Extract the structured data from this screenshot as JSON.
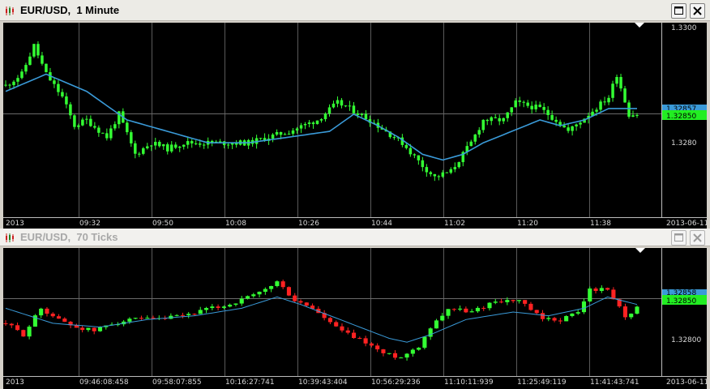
{
  "windows": [
    {
      "title": "EUR/USD,  1 Minute",
      "time_labels": [
        "2013",
        "09:32",
        "09:50",
        "10:08",
        "10:26",
        "10:44",
        "11:02",
        "11:20",
        "11:38",
        "2013-06-11"
      ],
      "price_labels": [
        "1.3300",
        "1.3280"
      ],
      "current_price": "1.32850",
      "ma_price": "1.32857",
      "chart_data": {
        "type": "candlestick",
        "instrument": "EUR/USD",
        "timeframe": "1 Minute",
        "x_labels": [
          "09:32",
          "09:50",
          "10:08",
          "10:26",
          "10:44",
          "11:02",
          "11:20",
          "11:38"
        ],
        "ylim": [
          1.3267,
          1.3301
        ],
        "bar_count": 157,
        "moving_average": true,
        "candle_colors": {
          "up": "#33ff33",
          "down": "#33ff33"
        },
        "ma_color": "#3a9ad8",
        "close_path": [
          [
            0,
            1.329
          ],
          [
            4,
            1.3292
          ],
          [
            7,
            1.3297
          ],
          [
            10,
            1.3292
          ],
          [
            14,
            1.3288
          ],
          [
            17,
            1.3283
          ],
          [
            20,
            1.3284
          ],
          [
            25,
            1.3281
          ],
          [
            28,
            1.3285
          ],
          [
            32,
            1.3278
          ],
          [
            36,
            1.328
          ],
          [
            40,
            1.3279
          ],
          [
            44,
            1.328
          ],
          [
            52,
            1.328
          ],
          [
            60,
            1.328
          ],
          [
            70,
            1.3282
          ],
          [
            77,
            1.3284
          ],
          [
            82,
            1.3287
          ],
          [
            85,
            1.3286
          ],
          [
            90,
            1.3284
          ],
          [
            94,
            1.3282
          ],
          [
            98,
            1.328
          ],
          [
            103,
            1.3276
          ],
          [
            106,
            1.3274
          ],
          [
            110,
            1.3275
          ],
          [
            115,
            1.328
          ],
          [
            118,
            1.3284
          ],
          [
            123,
            1.3284
          ],
          [
            126,
            1.3287
          ],
          [
            132,
            1.3286
          ],
          [
            136,
            1.3284
          ],
          [
            139,
            1.3282
          ],
          [
            144,
            1.3285
          ],
          [
            149,
            1.3288
          ],
          [
            151,
            1.3292
          ],
          [
            154,
            1.3285
          ],
          [
            156,
            1.3285
          ]
        ],
        "ma_path": [
          [
            0,
            1.3289
          ],
          [
            10,
            1.3292
          ],
          [
            20,
            1.3289
          ],
          [
            30,
            1.3284
          ],
          [
            40,
            1.3282
          ],
          [
            50,
            1.328
          ],
          [
            60,
            1.328
          ],
          [
            70,
            1.3281
          ],
          [
            80,
            1.3282
          ],
          [
            86,
            1.3285
          ],
          [
            92,
            1.3283
          ],
          [
            97,
            1.3281
          ],
          [
            103,
            1.3278
          ],
          [
            108,
            1.3277
          ],
          [
            113,
            1.3278
          ],
          [
            118,
            1.328
          ],
          [
            125,
            1.3282
          ],
          [
            132,
            1.3284
          ],
          [
            137,
            1.3283
          ],
          [
            143,
            1.3284
          ],
          [
            149,
            1.3286
          ],
          [
            152,
            1.3286
          ],
          [
            156,
            1.3286
          ]
        ],
        "seed": 11
      }
    },
    {
      "title": "EUR/USD,  70 Ticks",
      "time_labels": [
        "2013",
        "09:46:08:458",
        "09:58:07:855",
        "10:16:27:741",
        "10:39:43:404",
        "10:56:29:236",
        "11:10:11:939",
        "11:25:49:119",
        "11:41:43:741",
        "2013-06-11"
      ],
      "price_labels": [
        "1.32800"
      ],
      "current_price": "1.32850",
      "ma_price": "1.32858",
      "chart_data": {
        "type": "candlestick",
        "instrument": "EUR/USD",
        "timeframe": "70 Ticks",
        "x_labels": [
          "09:46:08:458",
          "09:58:07:855",
          "10:16:27:741",
          "10:39:43:404",
          "10:56:29:236",
          "11:10:11:939",
          "11:25:49:119",
          "11:41:43:741"
        ],
        "ylim": [
          1.3267,
          1.3301
        ],
        "bar_count": 108,
        "moving_average": true,
        "candle_colors": {
          "up": "#33ff33",
          "down": "#ff2222"
        },
        "ma_color": "#3a9ad8",
        "close_path": [
          [
            0,
            1.3281
          ],
          [
            3,
            1.3278
          ],
          [
            6,
            1.3285
          ],
          [
            9,
            1.3282
          ],
          [
            12,
            1.328
          ],
          [
            15,
            1.3279
          ],
          [
            18,
            1.3281
          ],
          [
            22,
            1.3282
          ],
          [
            26,
            1.3282
          ],
          [
            30,
            1.3283
          ],
          [
            35,
            1.3285
          ],
          [
            38,
            1.3286
          ],
          [
            43,
            1.3289
          ],
          [
            46,
            1.3292
          ],
          [
            49,
            1.3287
          ],
          [
            52,
            1.3285
          ],
          [
            55,
            1.3281
          ],
          [
            58,
            1.3278
          ],
          [
            61,
            1.3276
          ],
          [
            64,
            1.3273
          ],
          [
            67,
            1.3272
          ],
          [
            70,
            1.3275
          ],
          [
            72,
            1.328
          ],
          [
            75,
            1.3285
          ],
          [
            79,
            1.3284
          ],
          [
            83,
            1.3287
          ],
          [
            87,
            1.3287
          ],
          [
            91,
            1.3282
          ],
          [
            94,
            1.3282
          ],
          [
            97,
            1.3284
          ],
          [
            99,
            1.329
          ],
          [
            102,
            1.329
          ],
          [
            105,
            1.3283
          ],
          [
            107,
            1.3285
          ]
        ],
        "ma_path": [
          [
            0,
            1.3285
          ],
          [
            8,
            1.3281
          ],
          [
            16,
            1.328
          ],
          [
            24,
            1.3282
          ],
          [
            32,
            1.3283
          ],
          [
            40,
            1.3285
          ],
          [
            46,
            1.3288
          ],
          [
            50,
            1.3286
          ],
          [
            55,
            1.3283
          ],
          [
            60,
            1.328
          ],
          [
            65,
            1.3277
          ],
          [
            68,
            1.3276
          ],
          [
            72,
            1.3278
          ],
          [
            78,
            1.3282
          ],
          [
            86,
            1.3284
          ],
          [
            92,
            1.3283
          ],
          [
            98,
            1.3285
          ],
          [
            102,
            1.3288
          ],
          [
            107,
            1.3286
          ]
        ],
        "seed": 29
      }
    }
  ]
}
